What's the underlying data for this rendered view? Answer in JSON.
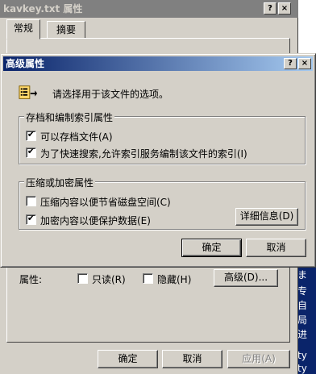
{
  "properties_window": {
    "title": "kavkey.txt 属性",
    "help_glyph": "?",
    "close_glyph": "×",
    "tabs": [
      {
        "label": "常规",
        "active": true
      },
      {
        "label": "摘要",
        "active": false
      }
    ],
    "attributes_label": "属性:",
    "readonly_label": "只读(R)",
    "readonly_checked": false,
    "hidden_label": "隐藏(H)",
    "hidden_checked": false,
    "advanced_button": "高级(D)...",
    "ok_button": "确定",
    "cancel_button": "取消",
    "apply_button": "应用(A)"
  },
  "advanced_dialog": {
    "title": "高级属性",
    "help_glyph": "?",
    "close_glyph": "×",
    "intro_icon": "file-attributes-icon",
    "intro_text": "请选择用于该文件的选项。",
    "archive_group": {
      "title": "存档和编制索引属性",
      "options": [
        {
          "label": "可以存档文件(A)",
          "checked": true
        },
        {
          "label": "为了快速搜索,允许索引服务编制该文件的索引(I)",
          "checked": true
        }
      ]
    },
    "compress_group": {
      "title": "压缩或加密属性",
      "options": [
        {
          "label": "压缩内容以便节省磁盘空间(C)",
          "checked": false
        },
        {
          "label": "加密内容以便保护数据(E)",
          "checked": true
        }
      ],
      "details_button": "详细信息(D)"
    },
    "ok_button": "确定",
    "cancel_button": "取消"
  },
  "desktop_fragment": {
    "lines": [
      "ま",
      "专",
      "自",
      "局",
      "进",
      "ty",
      "ty"
    ]
  },
  "colors": {
    "face": "#d4d0c8",
    "active_title_start": "#0a246a",
    "active_title_end": "#a6caf0",
    "inactive_title": "#808080"
  }
}
